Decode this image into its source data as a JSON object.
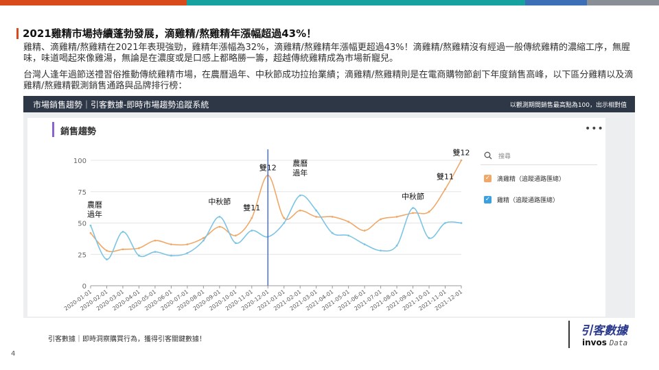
{
  "colors": {
    "bar_1": "#d84a1b",
    "bar_2": "#17a2a0",
    "bar_3": "#3c6fb5",
    "bar_4": "#8a8f96",
    "accent": "#d84a1b",
    "orange_series": "#f0a868",
    "blue_series": "#7cc4e4",
    "marker_line": "#4a6fd6"
  },
  "slide": {
    "title": "2021雞精市場持續蓬勃發展，滴雞精/熬雞精年漲幅超過43%！",
    "para1": "雞精、滴雞精/熬雞精在2021年表現強勁，雞精年漲幅為32%，滴雞精/熬雞精年漲幅更超過43%！滴雞精/熬雞精沒有經過一般傳統雞精的濃縮工序，無腥味，味道喝起來像雞湯，無論是在濃度或是口感上都略勝一籌，超越傳統雞精成為市場新寵兒。",
    "para2": "台灣人逢年過節送禮習俗推動傳統雞精市場，在農曆過年、中秋節成功拉抬業績；滴雞精/熬雞精則是在電商購物節創下年度銷售高峰，以下區分雞精以及滴雞精/熬雞精觀測銷售通路與品牌排行榜：",
    "page_number": "4",
    "footer": "引客數據｜即時洞察購買行為，獲得引客關鍵數據！"
  },
  "chart_header": {
    "title": "市場銷售趨勢｜引客數據-即時市場趨勢追蹤系統",
    "note": "以觀測期間銷售最高點為100，出示相對值"
  },
  "card": {
    "title": "銷售趨勢",
    "more_icon": "more-dots-icon",
    "search_placeholder": "搜尋"
  },
  "legend": [
    {
      "label": "滴雞精（追蹤通路匯總）",
      "checked": true,
      "color": "#f0a868"
    },
    {
      "label": "雞精（追蹤通路匯總）",
      "checked": true,
      "color": "#3aa0e0"
    }
  ],
  "logo": {
    "cn": "引客數據",
    "en_bold": "invos",
    "en_italic": "Data"
  },
  "chart_data": {
    "type": "line",
    "title": "銷售趨勢",
    "x": [
      "2020-01-01",
      "2020-02-01",
      "2020-03-01",
      "2020-04-01",
      "2020-05-01",
      "2020-06-01",
      "2020-07-01",
      "2020-08-01",
      "2020-09-01",
      "2020-10-01",
      "2020-11-01",
      "2020-12-01",
      "2021-01-01",
      "2021-02-01",
      "2021-03-01",
      "2021-04-01",
      "2021-05-01",
      "2021-06-01",
      "2021-07-01",
      "2021-08-01",
      "2021-09-01",
      "2021-10-01",
      "2021-11-01",
      "2021-12-01"
    ],
    "series": [
      {
        "name": "滴雞精（追蹤通路匯總）",
        "values": [
          42,
          28,
          29,
          30,
          36,
          33,
          33,
          38,
          47,
          40,
          54,
          88,
          54,
          60,
          55,
          55,
          51,
          44,
          53,
          55,
          58,
          59,
          77,
          100
        ]
      },
      {
        "name": "雞精（追蹤通路匯總）",
        "values": [
          48,
          21,
          43,
          24,
          27,
          24,
          26,
          36,
          55,
          34,
          44,
          39,
          50,
          72,
          60,
          42,
          40,
          33,
          28,
          32,
          62,
          38,
          50,
          50
        ]
      }
    ],
    "ylim": [
      0,
      100
    ],
    "yticks": [
      0,
      25,
      50,
      75,
      100
    ],
    "grid": true,
    "legend_position": "right",
    "marker_x": "2020-12-01",
    "annotations": [
      {
        "label": "農曆\n過年",
        "x": "2020-01-01",
        "y": 55
      },
      {
        "label": "中秋節",
        "x": "2020-09-01",
        "y": 65
      },
      {
        "label": "雙11",
        "x": "2020-11-01",
        "y": 60
      },
      {
        "label": "雙12",
        "x": "2020-12-01",
        "y": 92
      },
      {
        "label": "農曆\n過年",
        "x": "2021-02-01",
        "y": 88
      },
      {
        "label": "中秋節",
        "x": "2021-09-01",
        "y": 69
      },
      {
        "label": "雙11",
        "x": "2021-11-01",
        "y": 85
      },
      {
        "label": "雙12",
        "x": "2021-12-01",
        "y": 104
      }
    ]
  }
}
